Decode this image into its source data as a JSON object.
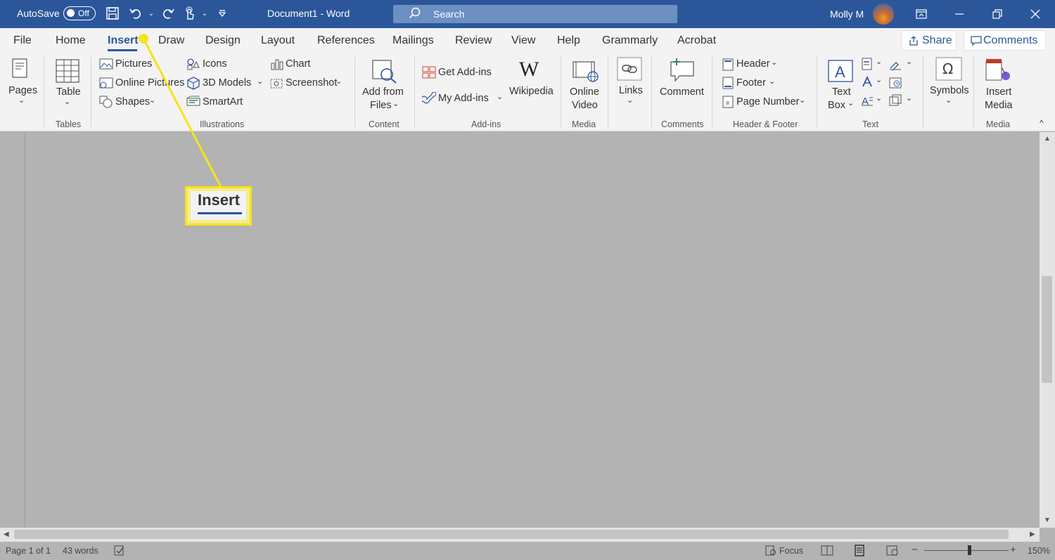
{
  "title_bar": {
    "autosave_label": "AutoSave",
    "autosave_state": "Off",
    "doc_title": "Document1  -  Word",
    "search_placeholder": "Search",
    "user_name": "Molly M",
    "quick_access": [
      "save-icon",
      "undo-icon",
      "redo-icon",
      "touch-mode-icon",
      "customize-icon"
    ],
    "window_buttons": [
      "ribbon-display-icon",
      "minimize-icon",
      "restore-icon",
      "close-icon"
    ],
    "accent_color": "#2b579a"
  },
  "tabs": [
    {
      "label": "File"
    },
    {
      "label": "Home"
    },
    {
      "label": "Insert",
      "active": true
    },
    {
      "label": "Draw"
    },
    {
      "label": "Design"
    },
    {
      "label": "Layout"
    },
    {
      "label": "References"
    },
    {
      "label": "Mailings"
    },
    {
      "label": "Review"
    },
    {
      "label": "View"
    },
    {
      "label": "Help"
    },
    {
      "label": "Grammarly"
    },
    {
      "label": "Acrobat"
    }
  ],
  "share_label": "Share",
  "comments_label": "Comments",
  "ribbon": {
    "pages": {
      "button": "Pages"
    },
    "tables": {
      "button": "Table",
      "group": "Tables"
    },
    "illustrations": {
      "pictures": "Pictures",
      "online_pictures": "Online Pictures",
      "shapes": "Shapes",
      "icons": "Icons",
      "models": "3D Models",
      "smartart": "SmartArt",
      "chart": "Chart",
      "screenshot": "Screenshot",
      "group": "Illustrations"
    },
    "content": {
      "add_line1": "Add from",
      "add_line2": "Files",
      "group": "Content"
    },
    "addins": {
      "get": "Get Add-ins",
      "my": "My Add-ins",
      "wikipedia": "Wikipedia",
      "group": "Add-ins"
    },
    "media": {
      "line1": "Online",
      "line2": "Video",
      "group": "Media"
    },
    "links": {
      "button": "Links"
    },
    "comments": {
      "button": "Comment",
      "group": "Comments"
    },
    "header_footer": {
      "header": "Header",
      "footer": "Footer",
      "page_number": "Page Number",
      "group": "Header & Footer"
    },
    "text": {
      "line1": "Text",
      "line2": "Box",
      "group": "Text"
    },
    "symbols": {
      "button": "Symbols"
    },
    "insert_media": {
      "line1": "Insert",
      "line2": "Media",
      "group": "Media"
    }
  },
  "callout": {
    "label": "Insert",
    "highlight_color": "#f5e419"
  },
  "status_bar": {
    "page": "Page 1 of 1",
    "words": "43 words",
    "focus": "Focus",
    "zoom": "150%",
    "zoom_minus": "−",
    "zoom_plus": "+"
  }
}
